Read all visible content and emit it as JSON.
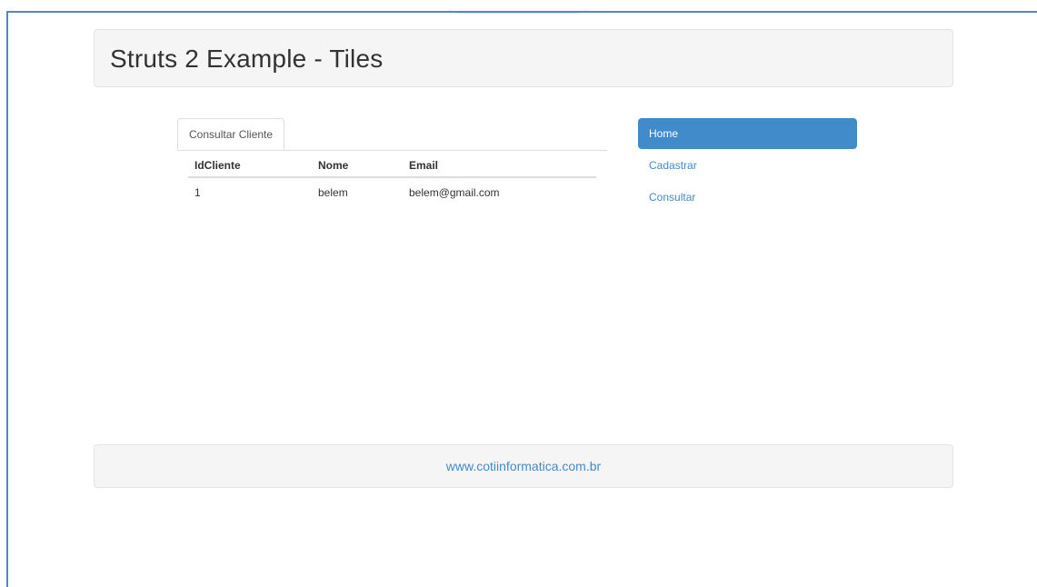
{
  "header": {
    "title": "Struts 2 Example - Tiles"
  },
  "tabs": [
    {
      "label": "Consultar Cliente"
    }
  ],
  "table": {
    "columns": [
      "IdCliente",
      "Nome",
      "Email"
    ],
    "rows": [
      [
        "1",
        "belem",
        "belem@gmail.com"
      ]
    ]
  },
  "nav": {
    "items": [
      {
        "label": "Home",
        "active": true
      },
      {
        "label": "Cadastrar",
        "active": false
      },
      {
        "label": "Consultar",
        "active": false
      }
    ]
  },
  "footer": {
    "link": "www.cotiinformatica.com.br"
  },
  "colors": {
    "accent": "#428bca",
    "panel": "#f5f5f5",
    "frame": "#5b86bd"
  }
}
